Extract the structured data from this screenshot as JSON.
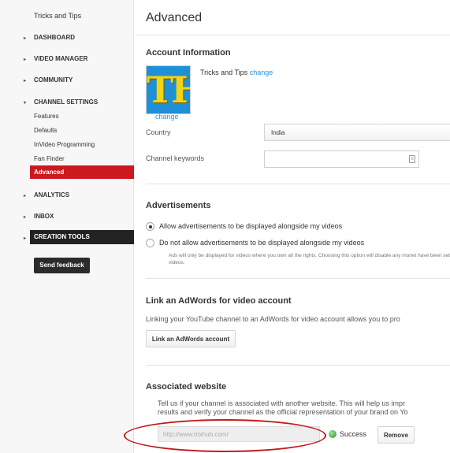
{
  "sidebar": {
    "channel_name": "Tricks and Tips",
    "items": [
      {
        "label": "DASHBOARD"
      },
      {
        "label": "VIDEO MANAGER"
      },
      {
        "label": "COMMUNITY"
      },
      {
        "label": "CHANNEL SETTINGS"
      },
      {
        "label": "ANALYTICS"
      },
      {
        "label": "INBOX"
      }
    ],
    "sub_items": [
      "Features",
      "Defaults",
      "InVideo Programming",
      "Fan Finder"
    ],
    "active_item": "Advanced",
    "creation_tools": "CREATION TOOLS",
    "send_feedback": "Send feedback"
  },
  "header": {
    "title": "Advanced"
  },
  "account": {
    "title": "Account Information",
    "avatar_text": "TH",
    "avatar_change": "change",
    "channel_name": "Tricks and Tips",
    "name_change": "change",
    "country_label": "Country",
    "country_value": "India",
    "keywords_label": "Channel keywords",
    "keywords_value": ""
  },
  "ads": {
    "title": "Advertisements",
    "option_allow": "Allow advertisements to be displayed alongside my videos",
    "option_disallow": "Do not allow advertisements to be displayed alongside my videos",
    "note": "Ads will only be displayed for videos where you own all the rights. Choosing this option will disable any monet have been set for your videos.",
    "selected": "allow"
  },
  "adwords": {
    "title": "Link an AdWords for video account",
    "description": "Linking your YouTube channel to an AdWords for video account allows you to pro",
    "button": "Link an AdWords account"
  },
  "website": {
    "title": "Associated website",
    "description_line1": "Tell us if your channel is associated with another website. This will help us impr",
    "description_line2": "results and verify your channel as the official representation of your brand on Yo",
    "url_placeholder": "http://www.trixhub.com/",
    "status": "Success",
    "remove": "Remove"
  },
  "colors": {
    "active_red": "#cc181e",
    "link_blue": "#2793e6",
    "success_green": "#2e9a2a",
    "annotation_red": "#c41a1a"
  }
}
